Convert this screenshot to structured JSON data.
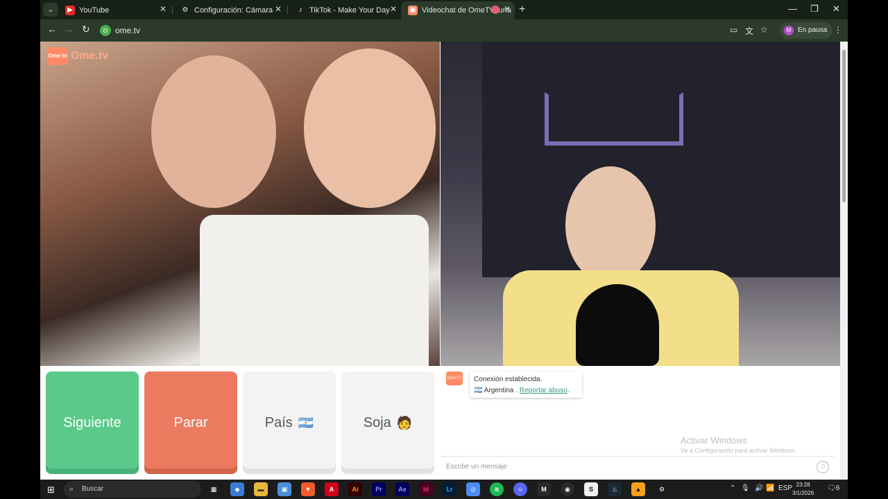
{
  "tabs": [
    {
      "title": "YouTube",
      "icon": "youtube-icon"
    },
    {
      "title": "Configuración: Cámara",
      "icon": "gear-icon"
    },
    {
      "title": "TikTok - Make Your Day",
      "icon": "tiktok-icon"
    },
    {
      "title": "Videochat de OmeTV: una",
      "icon": "ometv-icon",
      "active": true
    }
  ],
  "omnibox": {
    "url": "ome.tv"
  },
  "profile": {
    "label": "En pausa",
    "initial": "M"
  },
  "ometv": {
    "logo_small": "Ome tv",
    "logo_text": "Ome.tv"
  },
  "controls": {
    "next": "Siguiente",
    "stop": "Parar",
    "country": "País",
    "country_flag": "🇦🇷",
    "gender": "Soja",
    "gender_emoji": "🧑"
  },
  "chat": {
    "status": "Conexión establecida.",
    "country": "Argentina",
    "separator": ".",
    "report": "Reportar abuso",
    "report_suffix": ".",
    "input_placeholder": "Escribe un mensaje"
  },
  "watermark": {
    "title": "Activar Windows",
    "subtitle": "Ve a Configuración para activar Windows."
  },
  "taskbar": {
    "search": "Buscar",
    "lang": "ESP",
    "time": "23:28",
    "date": "3/1/2026",
    "notifications": "6"
  }
}
